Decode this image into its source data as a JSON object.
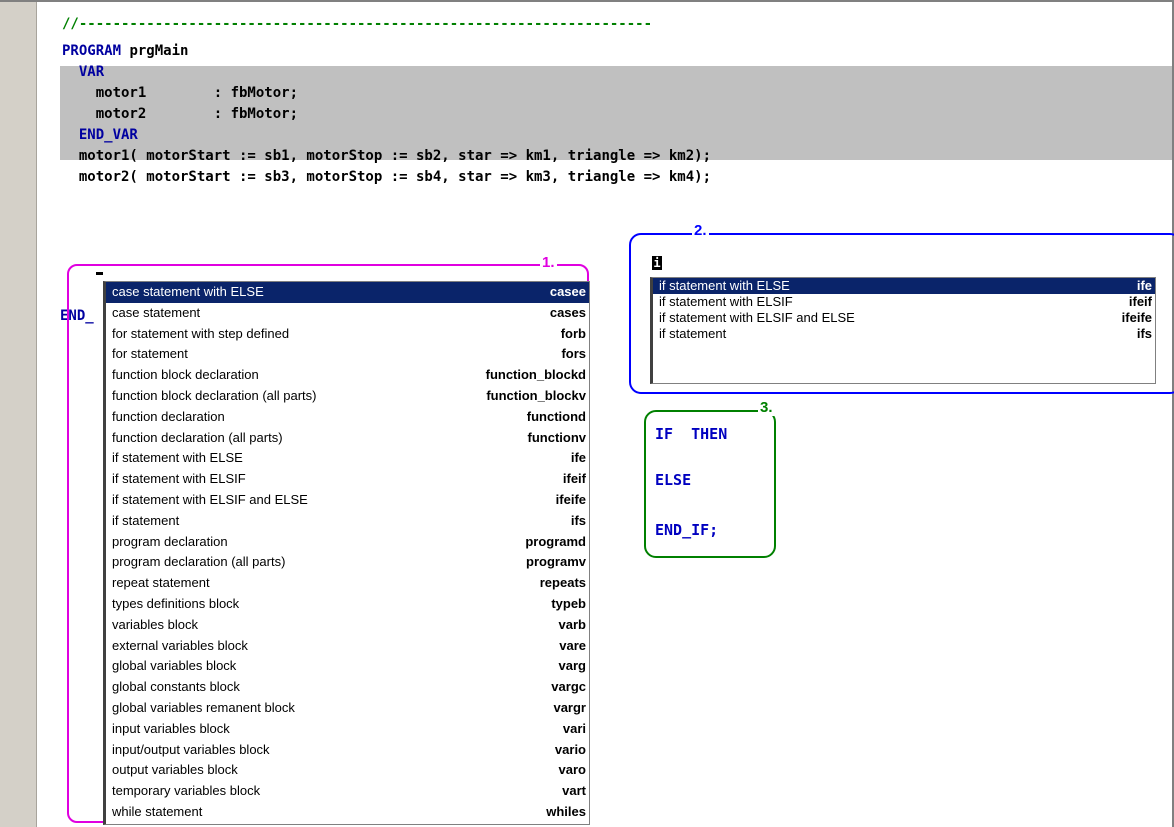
{
  "editor": {
    "lines": [
      {
        "text": "//--------------------------------------------------------------------",
        "kind": "comment"
      },
      {
        "text": "PROGRAM prgMain",
        "kind": "mixed"
      },
      {
        "text": "  VAR",
        "kind": "keyword"
      },
      {
        "text": "    motor1        : fbMotor;",
        "kind": "text"
      },
      {
        "text": "    motor2        : fbMotor;",
        "kind": "text"
      },
      {
        "text": "  END_VAR",
        "kind": "keyword"
      },
      {
        "text": "  motor1( motorStart := sb1, motorStop := sb2, star => km1, triangle => km2);",
        "kind": "text"
      },
      {
        "text": "  motor2( motorStart := sb3, motorStop := sb4, star => km3, triangle => km4);",
        "kind": "text"
      }
    ],
    "program_kw": "PROGRAM",
    "program_name": " prgMain",
    "end_fragment": "END_"
  },
  "callouts": {
    "one": "1.",
    "two": "2.",
    "three": "3."
  },
  "list1": {
    "items": [
      {
        "label": "case statement with ELSE",
        "shortcut": "casee",
        "selected": true
      },
      {
        "label": "case statement",
        "shortcut": "cases"
      },
      {
        "label": "for statement with step defined",
        "shortcut": "forb"
      },
      {
        "label": "for statement",
        "shortcut": "fors"
      },
      {
        "label": "function block declaration",
        "shortcut": "function_blockd"
      },
      {
        "label": "function block declaration (all parts)",
        "shortcut": "function_blockv"
      },
      {
        "label": "function declaration",
        "shortcut": "functiond"
      },
      {
        "label": "function declaration (all parts)",
        "shortcut": "functionv"
      },
      {
        "label": "if statement with ELSE",
        "shortcut": "ife"
      },
      {
        "label": "if statement with ELSIF",
        "shortcut": "ifeif"
      },
      {
        "label": "if statement with ELSIF and ELSE",
        "shortcut": "ifeife"
      },
      {
        "label": "if statement",
        "shortcut": "ifs"
      },
      {
        "label": "program declaration",
        "shortcut": "programd"
      },
      {
        "label": "program declaration (all parts)",
        "shortcut": "programv"
      },
      {
        "label": "repeat statement",
        "shortcut": "repeats"
      },
      {
        "label": "types definitions block",
        "shortcut": "typeb"
      },
      {
        "label": "variables block",
        "shortcut": "varb"
      },
      {
        "label": "external variables block",
        "shortcut": "vare"
      },
      {
        "label": "global variables block",
        "shortcut": "varg"
      },
      {
        "label": "global constants block",
        "shortcut": "vargc"
      },
      {
        "label": "global variables remanent block",
        "shortcut": "vargr"
      },
      {
        "label": "input variables block",
        "shortcut": "vari"
      },
      {
        "label": "input/output variables block",
        "shortcut": "vario"
      },
      {
        "label": "output variables block",
        "shortcut": "varo"
      },
      {
        "label": "temporary variables block",
        "shortcut": "vart"
      },
      {
        "label": "while statement",
        "shortcut": "whiles"
      }
    ]
  },
  "list2": {
    "typed": "i",
    "items": [
      {
        "label": "if statement with ELSE",
        "shortcut": "ife",
        "selected": true
      },
      {
        "label": "if statement with ELSIF",
        "shortcut": "ifeif"
      },
      {
        "label": "if statement with ELSIF and ELSE",
        "shortcut": "ifeife"
      },
      {
        "label": "if statement",
        "shortcut": "ifs"
      }
    ]
  },
  "snippet": {
    "line1": "IF  THEN",
    "line2": "ELSE",
    "line3": "END_IF;"
  },
  "colors": {
    "keyword": "#0000a0",
    "comment": "#008000",
    "selection": "#0a246a",
    "frame1": "#e000e0",
    "frame2": "#0000ff",
    "frame3": "#008000"
  }
}
